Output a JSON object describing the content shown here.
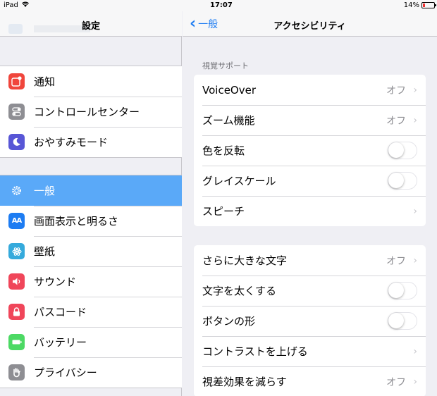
{
  "status_bar": {
    "carrier": "iPad",
    "time": "17:07",
    "battery": "14%"
  },
  "left": {
    "title": "設定",
    "groups": [
      {
        "items": [
          {
            "label": "通知",
            "icon": "notifications-icon",
            "color": "#f0463c"
          },
          {
            "label": "コントロールセンター",
            "icon": "control-center-icon",
            "color": "#8e8e93"
          },
          {
            "label": "おやすみモード",
            "icon": "do-not-disturb-icon",
            "color": "#5856d6"
          }
        ]
      },
      {
        "items": [
          {
            "label": "一般",
            "icon": "gear-icon",
            "color": "#8e8e93",
            "selected": true
          },
          {
            "label": "画面表示と明るさ",
            "icon": "display-brightness-icon",
            "color": "#1d7cf2"
          },
          {
            "label": "壁紙",
            "icon": "wallpaper-icon",
            "color": "#35aadc"
          },
          {
            "label": "サウンド",
            "icon": "speaker-icon",
            "color": "#f0465a"
          },
          {
            "label": "パスコード",
            "icon": "lock-icon",
            "color": "#f0465a"
          },
          {
            "label": "バッテリー",
            "icon": "battery-icon",
            "color": "#4cd964"
          },
          {
            "label": "プライバシー",
            "icon": "hand-icon",
            "color": "#8e8e93"
          }
        ]
      }
    ]
  },
  "right": {
    "back_label": "一般",
    "title": "アクセシビリティ",
    "sections": [
      {
        "header": "視覚サポート",
        "rows": [
          {
            "label": "VoiceOver",
            "value": "オフ",
            "type": "disclosure"
          },
          {
            "label": "ズーム機能",
            "value": "オフ",
            "type": "disclosure"
          },
          {
            "label": "色を反転",
            "type": "toggle",
            "on": false
          },
          {
            "label": "グレイスケール",
            "type": "toggle",
            "on": false
          },
          {
            "label": "スピーチ",
            "type": "disclosure"
          }
        ]
      },
      {
        "header": "",
        "rows": [
          {
            "label": "さらに大きな文字",
            "value": "オフ",
            "type": "disclosure"
          },
          {
            "label": "文字を太くする",
            "type": "toggle",
            "on": false
          },
          {
            "label": "ボタンの形",
            "type": "toggle",
            "on": false
          },
          {
            "label": "コントラストを上げる",
            "type": "disclosure"
          },
          {
            "label": "視差効果を減らす",
            "value": "オフ",
            "type": "disclosure"
          }
        ]
      }
    ]
  }
}
